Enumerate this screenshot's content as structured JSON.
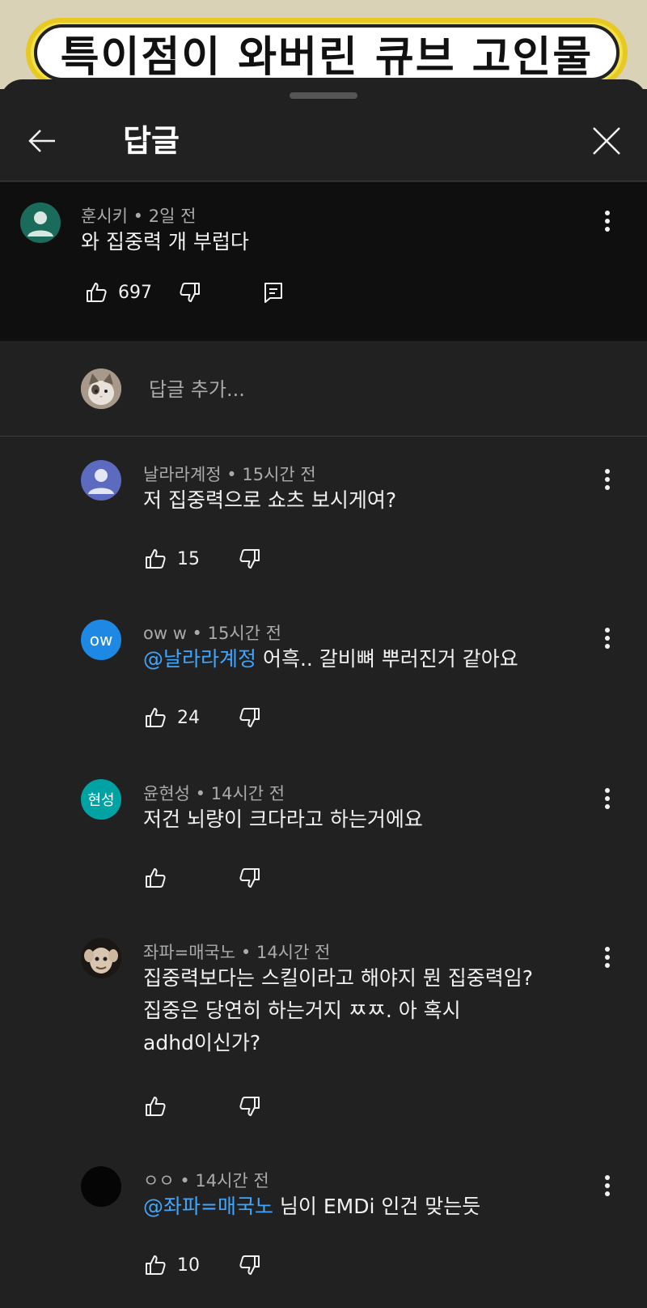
{
  "video": {
    "title": "특이점이 와버린 큐브 고인물"
  },
  "header": {
    "title": "답글"
  },
  "parent_comment": {
    "author": "훈시키",
    "time": "2일 전",
    "text": "와 집중력 개 부럽다",
    "likes": "697"
  },
  "reply_input": {
    "placeholder": "답글 추가..."
  },
  "replies": [
    {
      "author": "날라라계정",
      "time": "15시간 전",
      "mention": "",
      "text": "저 집중력으로 쇼츠 보시게여?",
      "likes": "15",
      "avatar_label": ""
    },
    {
      "author": "ow w",
      "time": "15시간 전",
      "mention": "@날라라계정",
      "text": "어흑.. 갈비뼈 뿌러진거 같아요",
      "likes": "24",
      "avatar_label": "ow"
    },
    {
      "author": "윤현성",
      "time": "14시간 전",
      "mention": "",
      "text": "저건 뇌량이 크다라고 하는거에요",
      "likes": "",
      "avatar_label": "현성"
    },
    {
      "author": "좌파=매국노",
      "time": "14시간 전",
      "mention": "",
      "text_lines": [
        "집중력보다는 스킬이라고 해야지 뭔 집중력임?",
        "집중은 당연히 하는거지 ㅉㅉ. 아 혹시",
        "adhd이신가?"
      ],
      "likes": "",
      "avatar_label": ""
    },
    {
      "author": "ㅇㅇ",
      "time": "14시간 전",
      "mention": "@좌파=매국노",
      "text": "님이 EMDi 인건 맞는듯",
      "likes": "10",
      "avatar_label": ""
    }
  ],
  "colors": {
    "background": "#212121",
    "parent_bg": "#0f0f0f",
    "mention": "#3ea6ff",
    "meta": "#aaaaaa"
  }
}
